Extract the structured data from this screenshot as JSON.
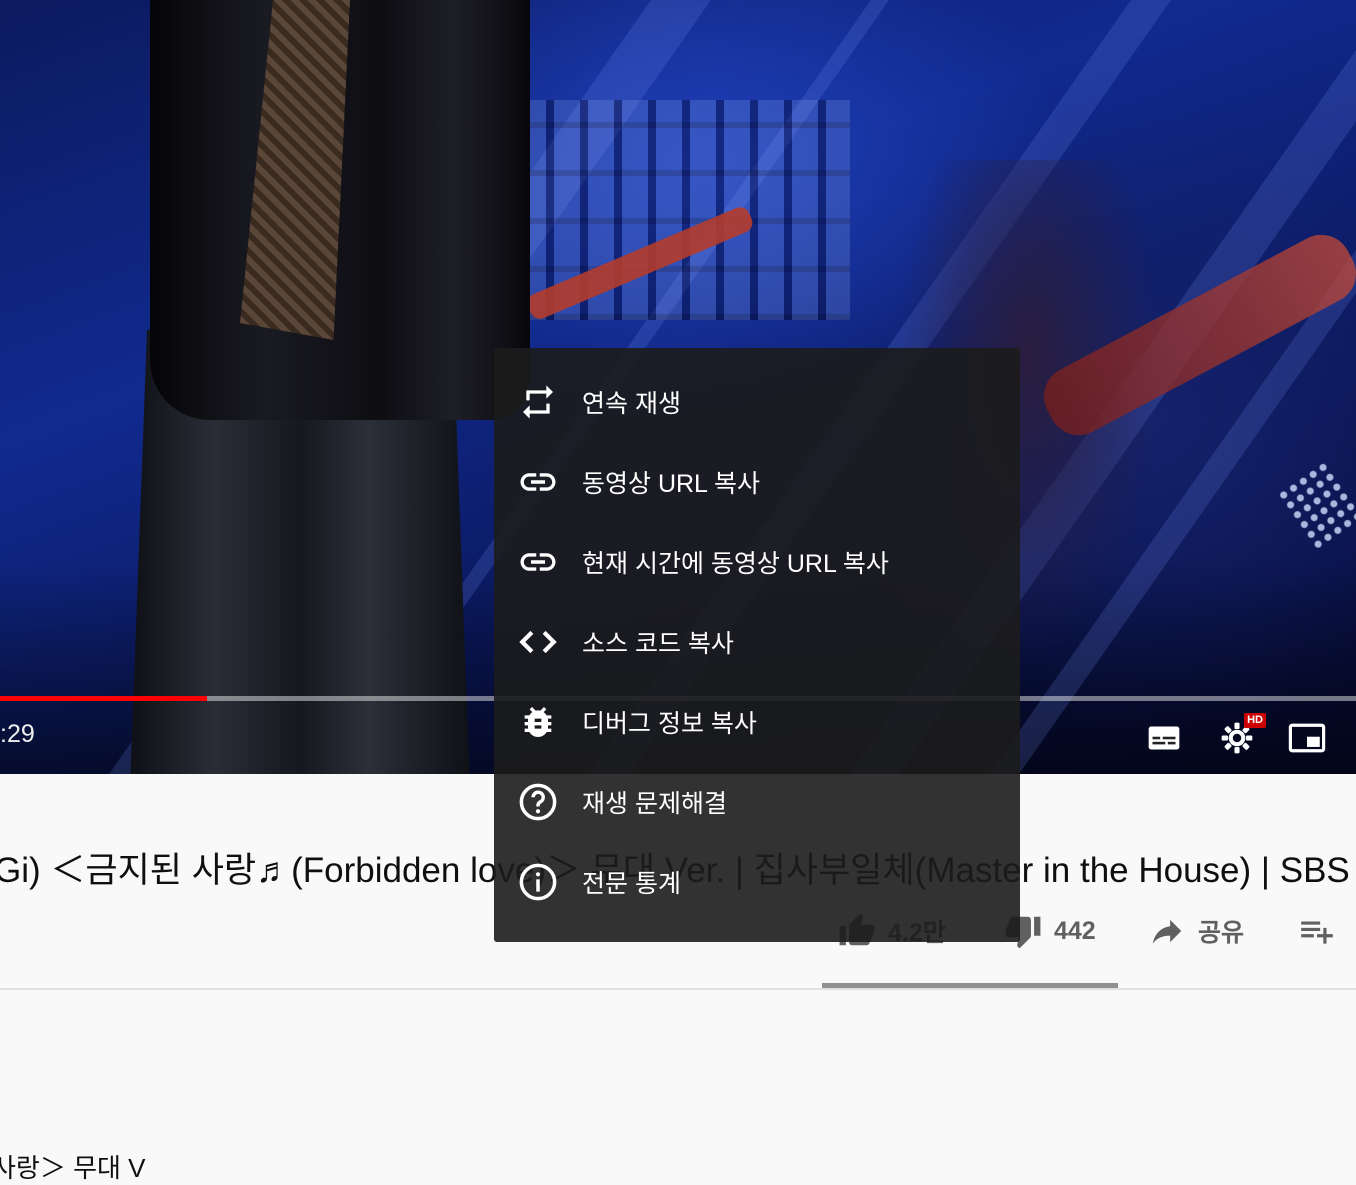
{
  "player": {
    "time_display": ":29",
    "progress_fraction": 0.153,
    "quality_badge": "HD"
  },
  "context_menu": {
    "items": [
      {
        "label": "연속 재생",
        "icon": "loop-icon"
      },
      {
        "label": "동영상 URL 복사",
        "icon": "link-icon"
      },
      {
        "label": "현재 시간에 동영상 URL 복사",
        "icon": "link-icon"
      },
      {
        "label": "소스 코드 복사",
        "icon": "code-icon"
      },
      {
        "label": "디버그 정보 복사",
        "icon": "bug-icon"
      },
      {
        "label": "재생 문제해결",
        "icon": "help-icon"
      },
      {
        "label": "전문 통계",
        "icon": "info-icon"
      }
    ]
  },
  "video": {
    "title": "Gi) ＜금지된 사랑♬(Forbidden love)＞ 무대 Ver. | 집사부일체(Master in the House) | SBS EN",
    "likes": "4.2만",
    "dislikes": "442",
    "share_label": "공유"
  },
  "description_peek": "사랑＞ 무대 V",
  "colors": {
    "accent_red": "#ff0000",
    "menu_bg": "#1c1c1c",
    "page_bg": "#f9f9f9"
  }
}
